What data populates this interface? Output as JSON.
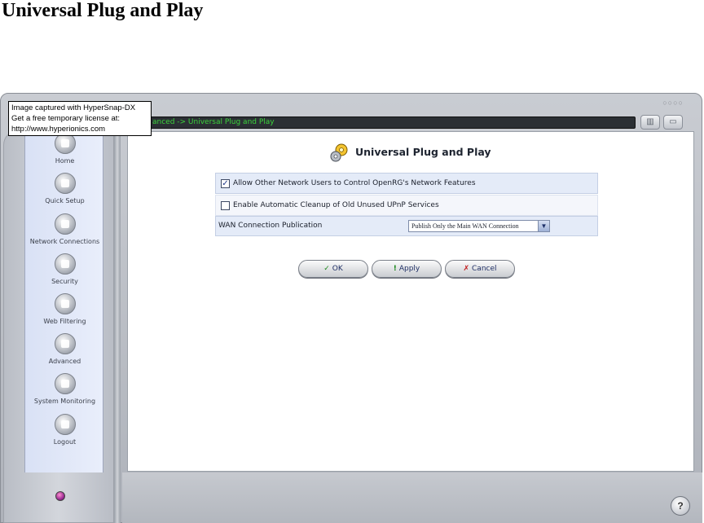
{
  "document": {
    "heading": "Universal Plug and Play"
  },
  "overlay": {
    "lines": [
      "Image captured with HyperSnap-DX",
      "Get a free temporary license at:",
      "http://www.hyperionics.com"
    ]
  },
  "header": {
    "breadcrumb": "anced -> Universal Plug and Play"
  },
  "sidebar": {
    "items": [
      {
        "label": "Home",
        "icon": "home-icon"
      },
      {
        "label": "Quick Setup",
        "icon": "wand-icon"
      },
      {
        "label": "Network Connections",
        "icon": "network-icon"
      },
      {
        "label": "Security",
        "icon": "lock-icon"
      },
      {
        "label": "Web Filtering",
        "icon": "filter-icon"
      },
      {
        "label": "Advanced",
        "icon": "tools-icon"
      },
      {
        "label": "System Monitoring",
        "icon": "monitor-icon"
      },
      {
        "label": "Logout",
        "icon": "logout-icon"
      }
    ]
  },
  "main": {
    "title": "Universal Plug and Play",
    "options": {
      "allow_control": {
        "label": "Allow Other Network Users to Control OpenRG's Network Features",
        "checked": true
      },
      "auto_cleanup": {
        "label": "Enable Automatic Cleanup of Old Unused UPnP Services",
        "checked": false
      }
    },
    "wan_publication": {
      "label": "WAN Connection Publication",
      "selected": "Publish Only the Main WAN Connection"
    },
    "buttons": {
      "ok": {
        "glyph": "✓",
        "label": "OK"
      },
      "apply": {
        "glyph": "!",
        "label": "Apply"
      },
      "cancel": {
        "glyph": "✗",
        "label": "Cancel"
      }
    }
  },
  "help": {
    "glyph": "?"
  },
  "colors": {
    "breadcrumb_text": "#3cd43c",
    "sidebar_bg": "#e3e9f8",
    "row_highlight": "#e4ebf8"
  }
}
